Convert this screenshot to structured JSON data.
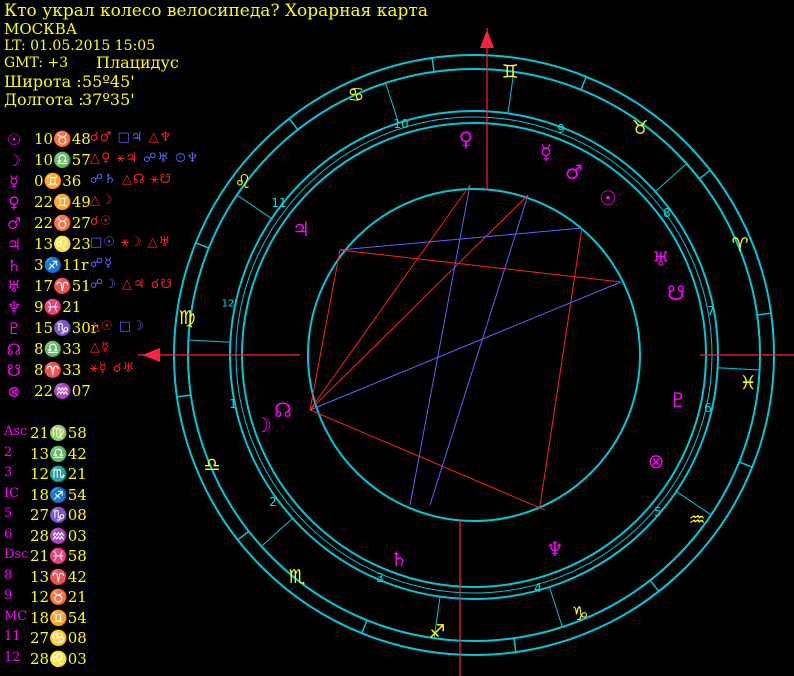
{
  "header": {
    "title": "Кто украл колесо велосипеда? Хорарная карта",
    "city": "МОСКВА",
    "lt": "LT: 01.05.2015  15:05",
    "gmt": "GMT: +3",
    "house_system": "Плацидус",
    "lat_label": "Широта :",
    "lat_value": "55º45'",
    "lon_label": "Долгота :",
    "lon_value": "37º35'"
  },
  "planets": [
    {
      "glyph": "☉",
      "pos": "10♉48",
      "aspects": [
        {
          "t": "☌♂",
          "c": "r"
        },
        {
          "t": "□♃",
          "c": "b"
        },
        {
          "t": "△♆",
          "c": "r"
        }
      ]
    },
    {
      "glyph": "☽",
      "pos": "10♎57",
      "aspects": [
        {
          "t": "△♀",
          "c": "r"
        },
        {
          "t": "⚹♃",
          "c": "r"
        },
        {
          "t": "☍♅",
          "c": "b"
        },
        {
          "t": "☉♆",
          "c": "b"
        }
      ]
    },
    {
      "glyph": "☿",
      "pos": "0♊36",
      "aspects": [
        {
          "t": "☍♄",
          "c": "b"
        },
        {
          "t": "△☊",
          "c": "r"
        },
        {
          "t": "⚹☋",
          "c": "r"
        }
      ]
    },
    {
      "glyph": "♀",
      "pos": "22♊49",
      "aspects": [
        {
          "t": "△☽",
          "c": "r"
        }
      ]
    },
    {
      "glyph": "♂",
      "pos": "22♉27",
      "aspects": [
        {
          "t": "☌☉",
          "c": "r"
        }
      ]
    },
    {
      "glyph": "♃",
      "pos": "13♌23",
      "aspects": [
        {
          "t": "□☉",
          "c": "b"
        },
        {
          "t": "⚹☽",
          "c": "r"
        },
        {
          "t": "△♅",
          "c": "r"
        }
      ]
    },
    {
      "glyph": "♄",
      "pos": "3♐11r",
      "aspects": [
        {
          "t": "☍☿",
          "c": "b"
        }
      ]
    },
    {
      "glyph": "♅",
      "pos": "17♈51",
      "aspects": [
        {
          "t": "☍☽",
          "c": "b"
        },
        {
          "t": "△♃",
          "c": "r"
        },
        {
          "t": "☌☋",
          "c": "r"
        }
      ]
    },
    {
      "glyph": "♆",
      "pos": "9♓21",
      "aspects": []
    },
    {
      "glyph": "♇",
      "pos": "15♑30r",
      "aspects": [
        {
          "t": "△☉",
          "c": "r"
        },
        {
          "t": "□☽",
          "c": "b"
        }
      ]
    },
    {
      "glyph": "☊",
      "pos": "8♎33",
      "aspects": [
        {
          "t": "△☿",
          "c": "r"
        }
      ]
    },
    {
      "glyph": "☋",
      "pos": "8♈33",
      "aspects": [
        {
          "t": "⚹☿",
          "c": "r"
        },
        {
          "t": "☌♅",
          "c": "r"
        }
      ]
    },
    {
      "glyph": "⊗",
      "pos": "22♒07",
      "aspects": []
    }
  ],
  "cusps": [
    {
      "label": "Asc",
      "pos": "21♍58"
    },
    {
      "label": "2",
      "pos": "13♎42"
    },
    {
      "label": "3",
      "pos": "12♏21"
    },
    {
      "label": "IC",
      "pos": "18♐54"
    },
    {
      "label": "5",
      "pos": "27♑08"
    },
    {
      "label": "6",
      "pos": "28♒03"
    },
    {
      "label": "Dsc",
      "pos": "21♓58"
    },
    {
      "label": "8",
      "pos": "13♈42"
    },
    {
      "label": "9",
      "pos": "12♉21"
    },
    {
      "label": "MC",
      "pos": "18♊54"
    },
    {
      "label": "11",
      "pos": "27♋08"
    },
    {
      "label": "12",
      "pos": "28♌03"
    }
  ],
  "wheel": {
    "signs": [
      "♈",
      "♉",
      "♊",
      "♋",
      "♌",
      "♍",
      "♎",
      "♏",
      "♐",
      "♑",
      "♒",
      "♓"
    ],
    "house_numbers": [
      "1",
      "2",
      "3",
      "4",
      "5",
      "6",
      "7",
      "8",
      "9",
      "10",
      "11",
      "12"
    ],
    "colors": {
      "ring": "#00c8d8",
      "sign": "#ffff00",
      "planet": "#ff00ff",
      "axis": "#ff2040",
      "house_num": "#00e0e0",
      "aspect_red": "#ff2020",
      "aspect_blue": "#6060ff"
    }
  }
}
